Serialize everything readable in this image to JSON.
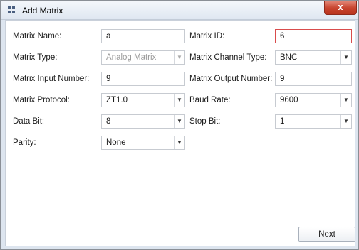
{
  "window": {
    "title": "Add Matrix",
    "close_glyph": "x",
    "icons": {
      "app": "matrix-grid-icon",
      "close": "close-icon",
      "dropdown": "chevron-down-icon"
    }
  },
  "form": {
    "matrix_name": {
      "label": "Matrix Name:",
      "value": "a"
    },
    "matrix_id": {
      "label": "Matrix ID:",
      "value": "6"
    },
    "matrix_type": {
      "label": "Matrix Type:",
      "value": "Analog Matrix",
      "enabled": false
    },
    "matrix_channel_type": {
      "label": "Matrix Channel Type:",
      "value": "BNC"
    },
    "matrix_input_number": {
      "label": "Matrix Input Number:",
      "value": "9"
    },
    "matrix_output_number": {
      "label": "Matrix Output Number:",
      "value": "9"
    },
    "matrix_protocol": {
      "label": "Matrix Protocol:",
      "value": "ZT1.0"
    },
    "baud_rate": {
      "label": "Baud Rate:",
      "value": "9600"
    },
    "data_bit": {
      "label": "Data Bit:",
      "value": "8"
    },
    "stop_bit": {
      "label": "Stop Bit:",
      "value": "1"
    },
    "parity": {
      "label": "Parity:",
      "value": "None"
    }
  },
  "footer": {
    "next_label": "Next"
  },
  "colors": {
    "close_button": "#c7432d",
    "focus_border": "#d94c4c",
    "disabled_text": "#9a9a9a"
  }
}
